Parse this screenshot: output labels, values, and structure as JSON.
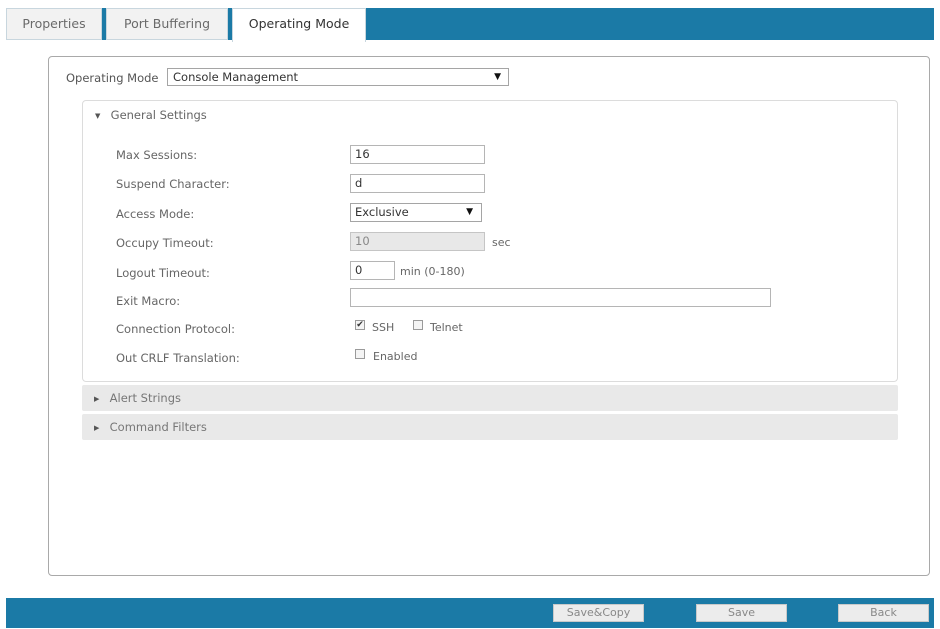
{
  "tabs": [
    {
      "label": "Properties",
      "active": false
    },
    {
      "label": "Port Buffering",
      "active": false
    },
    {
      "label": "Operating Mode",
      "active": true
    }
  ],
  "operating_mode": {
    "label": "Operating Mode",
    "value": "Console Management"
  },
  "general_settings": {
    "title": "General Settings",
    "expanded": true,
    "max_sessions": {
      "label": "Max Sessions:",
      "value": "16"
    },
    "suspend_character": {
      "label": "Suspend Character:",
      "value": "d"
    },
    "access_mode": {
      "label": "Access Mode:",
      "value": "Exclusive"
    },
    "occupy_timeout": {
      "label": "Occupy Timeout:",
      "value": "10",
      "unit": "sec",
      "disabled": true
    },
    "logout_timeout": {
      "label": "Logout Timeout:",
      "value": "0",
      "unit": "min (0-180)"
    },
    "exit_macro": {
      "label": "Exit Macro:",
      "value": ""
    },
    "connection_protocol": {
      "label": "Connection Protocol:",
      "ssh": {
        "label": "SSH",
        "checked": true
      },
      "telnet": {
        "label": "Telnet",
        "checked": false
      }
    },
    "out_crlf": {
      "label": "Out CRLF Translation:",
      "option_label": "Enabled",
      "checked": false
    }
  },
  "alert_strings": {
    "title": "Alert Strings",
    "expanded": false
  },
  "command_filters": {
    "title": "Command Filters",
    "expanded": false
  },
  "footer": {
    "save_copy_label": "Save&Copy",
    "save_label": "Save",
    "back_label": "Back"
  },
  "colors": {
    "accent": "#1b7aa6"
  },
  "icons": {
    "expanded": "triangle-down",
    "collapsed": "triangle-right",
    "dropdown": "triangle-down",
    "checked": "check-mark"
  }
}
